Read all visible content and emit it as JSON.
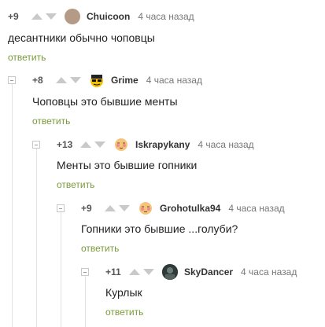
{
  "comments": [
    {
      "rating": "+9",
      "author": "Chuicoon",
      "time": "4 часа назад",
      "text": "десантники обычно чоповцы",
      "reply": "ответить",
      "avatar_color": "#b59a86"
    },
    {
      "rating": "+8",
      "author": "Grime",
      "time": "4 часа назад",
      "text": "Чоповцы это бывшие менты",
      "reply": "ответить",
      "avatar_color": "#f2c200"
    },
    {
      "rating": "+13",
      "author": "Iskrapykany",
      "time": "4 часа назад",
      "text": "Менты это бывшие гопники",
      "reply": "ответить",
      "avatar_color": "#f6c37a"
    },
    {
      "rating": "+9",
      "author": "Grohotulka94",
      "time": "4 часа назад",
      "text": "Гопники это бывшие ...голуби?",
      "reply": "ответить",
      "avatar_color": "#f6c37a"
    },
    {
      "rating": "+11",
      "author": "SkyDancer",
      "time": "4 часа назад",
      "text": "Курлык",
      "reply": "ответить",
      "avatar_color": "#3a3a3a"
    }
  ]
}
